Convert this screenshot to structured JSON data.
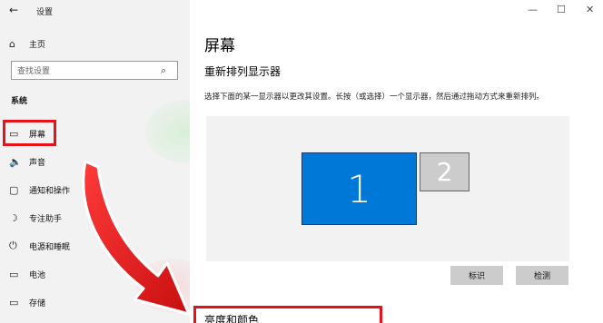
{
  "window": {
    "title": "设置",
    "min_icon": "—",
    "max_icon": "☐",
    "close_icon": "✕"
  },
  "sidebar": {
    "back_icon": "←",
    "home": {
      "icon": "⌂",
      "label": "主页"
    },
    "search": {
      "placeholder": "查找设置",
      "icon": "⌕"
    },
    "section_title": "系统",
    "items": [
      {
        "icon": "▭",
        "label": "屏幕"
      },
      {
        "icon": "🔈",
        "label": "声音"
      },
      {
        "icon": "▢",
        "label": "通知和操作"
      },
      {
        "icon": "☽",
        "label": "专注助手"
      },
      {
        "icon": "⏻",
        "label": "电源和睡眠"
      },
      {
        "icon": "▭",
        "label": "电池"
      },
      {
        "icon": "▭",
        "label": "存储"
      }
    ]
  },
  "main": {
    "title": "屏幕",
    "subtitle": "重新排列显示器",
    "description": "选择下面的某一显示器以更改其设置。长按（或选择）一个显示器，然后通过拖动方式来重新排列。",
    "monitors": [
      "1",
      "2"
    ],
    "identify_button": "标识",
    "detect_button": "检测",
    "next_section": "亮度和颜色"
  },
  "colors": {
    "accent": "#0078d7",
    "highlight": "#e3121b"
  }
}
